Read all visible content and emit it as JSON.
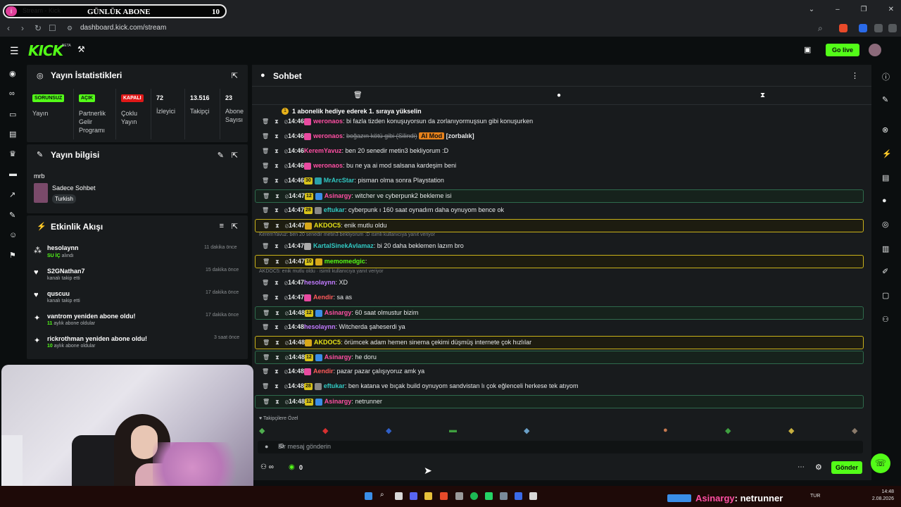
{
  "browser": {
    "tab_title": "Stream - Kick Dashboard",
    "url": "dashboard.kick.com/stream",
    "overlay_label": "GÜNLÜK ABONE",
    "overlay_count": "10"
  },
  "header": {
    "logo": "KICK",
    "beta": "BETA",
    "go_live": "Go live"
  },
  "stats_panel": {
    "title": "Yayın İstatistikleri",
    "items": [
      {
        "badge": "SORUNSUZ",
        "label": "Yayın"
      },
      {
        "badge": "AÇIK",
        "label": "Partnerlik Gelir Programı"
      },
      {
        "badge": "KAPALI",
        "label": "Çoklu Yayın"
      },
      {
        "value": "72",
        "label": "İzleyici"
      },
      {
        "value": "13.516",
        "label": "Takipçi"
      },
      {
        "value": "23",
        "label": "Abone Sayısı"
      }
    ]
  },
  "info_panel": {
    "title": "Yayın bilgisi",
    "stream_title": "mrb",
    "category": "Sadece Sohbet",
    "language": "Turkish"
  },
  "activity_panel": {
    "title": "Etkinlik Akışı",
    "items": [
      {
        "name": "hesolaynn",
        "sub_hl": "SU İÇ",
        "sub": "alındı",
        "time": "11 dakika önce"
      },
      {
        "name": "S2GNathan7",
        "sub_hl": "",
        "sub": "kanalı takip etti",
        "time": "15 dakika önce"
      },
      {
        "name": "quscuu",
        "sub_hl": "",
        "sub": "kanalı takip etti",
        "time": "17 dakika önce"
      },
      {
        "name": "vantrom yeniden abone oldu!",
        "sub_hl": "11",
        "sub": "aylık abone oldular",
        "time": "17 dakika önce"
      },
      {
        "name": "rickrothman yeniden abone oldu!",
        "sub_hl": "10",
        "sub": "aylık abone oldular",
        "time": "3 saat önce"
      }
    ]
  },
  "chat": {
    "title": "Sohbet",
    "pinned": "1 abonelik hediye ederek 1. sıraya yükselin",
    "rows": [
      {
        "time": "14:46",
        "user": "weronaos",
        "msg": "bi fazla tizden konuşuyorsun da zorlanıyormuşsun gibi konuşurken"
      },
      {
        "time": "14:46",
        "user": "weronaos",
        "msg": "boğazın kötü gibi (Silindi)",
        "tag": "AI Mod",
        "extra": "[zorbalık]"
      },
      {
        "time": "14:46",
        "user": "KeremYavuz",
        "msg": "ben 20 senedir metin3 bekliyorum :D"
      },
      {
        "time": "14:46",
        "user": "weronaos",
        "msg": "bu ne ya ai mod salsana kardeşim beni"
      },
      {
        "time": "14:46",
        "user": "MrArcStar",
        "msg": "pisman olma sonra Playstation",
        "badge": "30"
      },
      {
        "time": "14:47",
        "user": "Asinargy",
        "msg": "witcher ve cyberpunk2 bekleme isi",
        "badge": "12"
      },
      {
        "time": "14:47",
        "user": "eftukar",
        "msg": "cyberpunk ı 160 saat oynadım daha oynuyom bence ok",
        "badge": "28"
      },
      {
        "time": "14:47",
        "user": "AKDOC5",
        "msg": "enik mutlu oldu"
      },
      {
        "reply": "KeremYavuz: ben 20 senedir metin3 bekliyorum :D isimli kullanıcıya yanıt veriyor"
      },
      {
        "time": "14:47",
        "user": "KartalSinekAvlamaz",
        "msg": "bi 20 daha beklemen lazım bro"
      },
      {
        "time": "14:47",
        "user": "memomedgic",
        "msg": "",
        "badge": "10"
      },
      {
        "reply": "AKDOC5: enik mutlu oldu · isimli kullanıcıya yanıt veriyor"
      },
      {
        "time": "14:47",
        "user": "hesolaynn",
        "msg": "XD"
      },
      {
        "time": "14:47",
        "user": "Aendir",
        "msg": "sa as"
      },
      {
        "time": "14:48",
        "user": "Asinargy",
        "msg": "60 saat olmustur bizim",
        "badge": "12"
      },
      {
        "time": "14:48",
        "user": "hesolaynn",
        "msg": "Witcherda şaheserdi ya"
      },
      {
        "time": "14:48",
        "user": "AKDOC5",
        "msg": "örümcek adam hemen sinema çekimi düşmüş internete çok hızlılar"
      },
      {
        "time": "14:48",
        "user": "Asinargy",
        "msg": "he doru",
        "badge": "12"
      },
      {
        "time": "14:48",
        "user": "Aendir",
        "msg": "pazar pazar çalışıyoruz amk ya"
      },
      {
        "time": "14:48",
        "user": "eftukar",
        "msg": "ben katana ve bıçak build oynuyom sandvistan lı çok eğlenceli herkese tek atıyom",
        "badge": "28"
      },
      {
        "time": "14:48",
        "user": "Asinargy",
        "msg": "netrunner",
        "badge": "12"
      }
    ],
    "emote_section": "Takipçilere Özel",
    "input_placeholder": "Bir mesaj gönderin",
    "points": "0",
    "send": "Gönder"
  },
  "taskbar": {
    "overlay_user": "Asinargy",
    "overlay_msg": ": netrunner",
    "lang": "TUR",
    "time": "14:48",
    "date": "2.08.2026"
  },
  "colors": {
    "accent": "#53fc18",
    "panel": "#181b1d",
    "bg": "#0b0e0f"
  }
}
